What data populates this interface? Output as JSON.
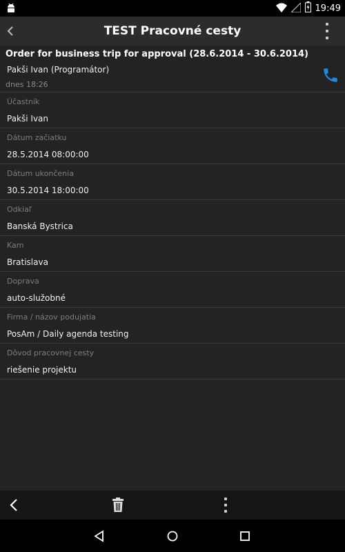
{
  "status_bar": {
    "time": "19:49",
    "icons": [
      "android-icon",
      "wifi-icon",
      "signal-icon",
      "battery-icon"
    ]
  },
  "action_bar": {
    "title": "TEST Pracovné cesty",
    "icons": [
      "back-arrow-icon",
      "overflow-menu-icon"
    ]
  },
  "header": {
    "title": "Order for business trip for approval (28.6.2014 - 30.6.2014)",
    "person": "Pakši Ivan (Programátor)",
    "timestamp": "dnes 18:26",
    "phone_icon": "phone-icon",
    "accent_color": "#1e88e5"
  },
  "fields": [
    {
      "label": "Účastník",
      "value": "Pakši Ivan"
    },
    {
      "label": "Dátum začiatku",
      "value": "28.5.2014 08:00:00"
    },
    {
      "label": "Dátum ukončenia",
      "value": "30.5.2014 18:00:00"
    },
    {
      "label": "Odkiaľ",
      "value": "Banská Bystrica"
    },
    {
      "label": "Kam",
      "value": "Bratislava"
    },
    {
      "label": "Doprava",
      "value": "auto-služobné"
    },
    {
      "label": "Firma / názov podujatia",
      "value": "PosAm / Daily agenda testing"
    },
    {
      "label": "Dôvod pracovnej cesty",
      "value": "riešenie projektu"
    }
  ],
  "bottom_bar": {
    "icons": [
      "back-chevron-icon",
      "trash-icon",
      "overflow-menu-icon"
    ]
  },
  "nav_bar": {
    "icons": [
      "nav-back-icon",
      "nav-home-icon",
      "nav-recents-icon"
    ]
  }
}
